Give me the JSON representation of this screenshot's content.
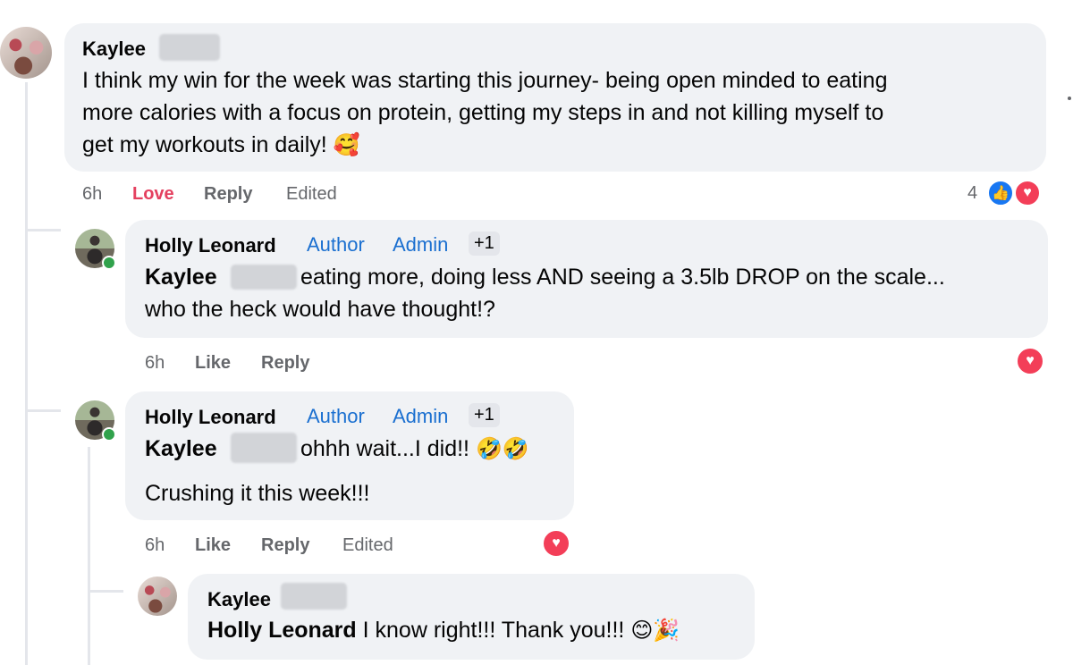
{
  "comments": [
    {
      "author": "Kaylee",
      "lines": [
        "I think my win for the week was starting this journey- being open minded to eating",
        "more calories with a focus on protein, getting my steps in and not killing myself to",
        "get my workouts in daily!"
      ],
      "emoji": "🥰",
      "time": "6h",
      "love_label": "Love",
      "reply_label": "Reply",
      "edited_label": "Edited",
      "reaction_count": "4"
    },
    {
      "author": "Holly Leonard",
      "badge_author": "Author",
      "badge_admin": "Admin",
      "badge_plus": "+1",
      "mention": "Kaylee",
      "text_line1": "eating more, doing less AND seeing a 3.5lb DROP on the scale...",
      "text_line2": "who the heck would have thought!?",
      "time": "6h",
      "like_label": "Like",
      "reply_label": "Reply"
    },
    {
      "author": "Holly Leonard",
      "badge_author": "Author",
      "badge_admin": "Admin",
      "badge_plus": "+1",
      "mention": "Kaylee",
      "text_line1": "ohhh wait...I did!!",
      "emoji": "🤣🤣",
      "text_line2": "Crushing it this week!!!",
      "time": "6h",
      "like_label": "Like",
      "reply_label": "Reply",
      "edited_label": "Edited"
    },
    {
      "author": "Kaylee",
      "mention": "Holly Leonard",
      "text": "I know right!!! Thank you!!!",
      "emoji": "😊🎉"
    }
  ],
  "icons": {
    "like": "thumbs-up-icon",
    "heart": "heart-icon"
  },
  "colors": {
    "bubble": "#f0f2f5",
    "link_blue": "#1a6fd0",
    "love_red": "#e4405f",
    "like_blue": "#1877f2",
    "online_green": "#31a24c"
  }
}
